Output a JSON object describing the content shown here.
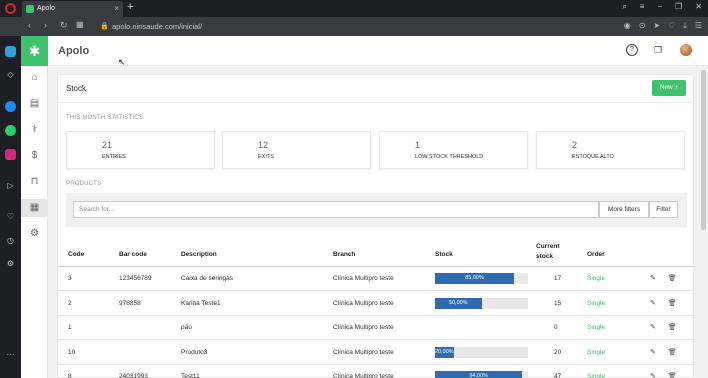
{
  "browser": {
    "tab_title": "Apolo",
    "url": "apolo.ninsaude.com/inicial/"
  },
  "app": {
    "name": "Apolo"
  },
  "page": {
    "title": "Stock",
    "new_button": "New +"
  },
  "stats": {
    "section_label": "THIS MONTH STATISTICS",
    "items": [
      {
        "value": "21",
        "label": "ENTRIES"
      },
      {
        "value": "12",
        "label": "EXITS"
      },
      {
        "value": "1",
        "label": "LOW STOCK THRESHOLD"
      },
      {
        "value": "2",
        "label": "ESTOQUE ALTO"
      }
    ]
  },
  "products": {
    "section_label": "PRODUCTS",
    "search_placeholder": "Search for...",
    "more_filters": "More filters",
    "filter": "Filter",
    "columns": {
      "code": "Code",
      "barcode": "Bar code",
      "description": "Description",
      "branch": "Branch",
      "stock": "Stock",
      "current_stock_1": "Current",
      "current_stock_2": "stock",
      "order": "Order"
    },
    "rows": [
      {
        "code": "3",
        "barcode": "123456789",
        "description": "Caixa de seringas",
        "branch": "Clínica Multipro teste",
        "stock_pct": "85,00%",
        "stock_fill": 0.85,
        "current": "17",
        "order": "Single"
      },
      {
        "code": "2",
        "barcode": "978858",
        "description": "Karina Teste1",
        "branch": "Clínica Multipro teste",
        "stock_pct": "50,00%",
        "stock_fill": 0.5,
        "current": "15",
        "order": "Single"
      },
      {
        "code": "1",
        "barcode": "",
        "description": "pão",
        "branch": "Clínica Multipro teste",
        "stock_pct": "",
        "stock_fill": 0,
        "current": "0",
        "order": "Single"
      },
      {
        "code": "10",
        "barcode": "",
        "description": "Produto3",
        "branch": "Clínica Multipro teste",
        "stock_pct": "20,00%",
        "stock_fill": 0.2,
        "current": "20",
        "order": "Single"
      },
      {
        "code": "8",
        "barcode": "24031993",
        "description": "Test11",
        "branch": "Clínica Multipro teste",
        "stock_pct": "94,00%",
        "stock_fill": 0.94,
        "current": "47",
        "order": "Single"
      }
    ]
  }
}
